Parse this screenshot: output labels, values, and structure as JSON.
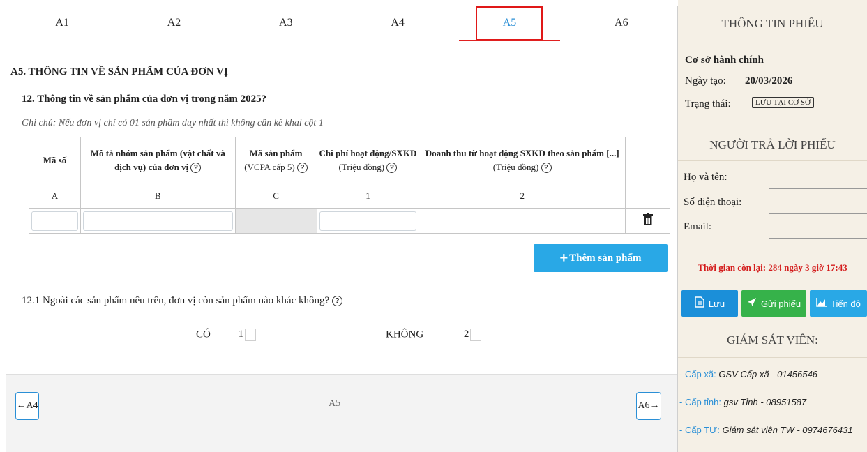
{
  "tabs": [
    {
      "label": "A1"
    },
    {
      "label": "A2"
    },
    {
      "label": "A3"
    },
    {
      "label": "A4"
    },
    {
      "label": "A5"
    },
    {
      "label": "A6"
    }
  ],
  "active_tab": "A5",
  "section_title": "A5. THÔNG TIN VỀ SẢN PHẨM CỦA ĐƠN VỊ",
  "question_12": "12. Thông tin về sản phẩm của đơn vị trong năm 2025?",
  "note": "Ghi chú: Nếu đơn vị chỉ có 01 sản phẩm duy nhất thì không cần kê khai cột 1",
  "table": {
    "headers": [
      {
        "main": "Mã số",
        "sub": ""
      },
      {
        "main": "Mô tả nhóm sản phẩm (vật chất và",
        "sub": "dịch vụ) của đơn vị"
      },
      {
        "main": "Mã sản phẩm",
        "sub": "(VCPA cấp 5)"
      },
      {
        "main": "Chi phí hoạt động/SXKD",
        "sub": "(Triệu đồng)"
      },
      {
        "main": "Doanh thu từ hoạt động SXKD theo sản phẩm [...]",
        "sub": "(Triệu đồng)"
      }
    ],
    "codes": [
      "A",
      "B",
      "C",
      "1",
      "2"
    ]
  },
  "add_button": "Thêm sản phẩm",
  "question_12_1": "12.1 Ngoài các sản phẩm nêu trên, đơn vị còn sản phẩm nào khác không?",
  "options": [
    {
      "label": "CÓ",
      "code": "1"
    },
    {
      "label": "KHÔNG",
      "code": "2"
    }
  ],
  "footer": {
    "prev": "←A4",
    "current": "A5",
    "next": "A6→"
  },
  "sidebar": {
    "title": "THÔNG TIN PHIẾU",
    "unit_type": "Cơ sở hành chính",
    "created_label": "Ngày tạo:",
    "created_value": "20/03/2026",
    "status_label": "Trạng thái:",
    "status_value": "LƯU TẠI CƠ SỞ",
    "respondent_title": "NGƯỜI TRẢ LỜI PHIẾU",
    "name_label": "Họ và tên:",
    "phone_label": "Số điện thoại:",
    "email_label": "Email:",
    "countdown": "Thời gian còn lại: 284 ngày 3 giờ 17:43",
    "save_button": "Lưu",
    "send_button": "Gửi phiếu",
    "progress_button": "Tiến độ",
    "supervisor_title": "GIÁM SÁT VIÊN:",
    "supervisors": [
      {
        "label": "- Cấp xã:",
        "value": "GSV Cấp xã - 01456546"
      },
      {
        "label": "- Cấp tỉnh:",
        "value": "gsv Tỉnh - 08951587"
      },
      {
        "label": "- Cấp TƯ:",
        "value": "Giám sát viên TW - 0974676431"
      }
    ],
    "colors": {
      "save": "#1b8fd9",
      "send": "#36b24a",
      "progress": "#29a8e6",
      "countdown": "#d41c1c"
    }
  }
}
